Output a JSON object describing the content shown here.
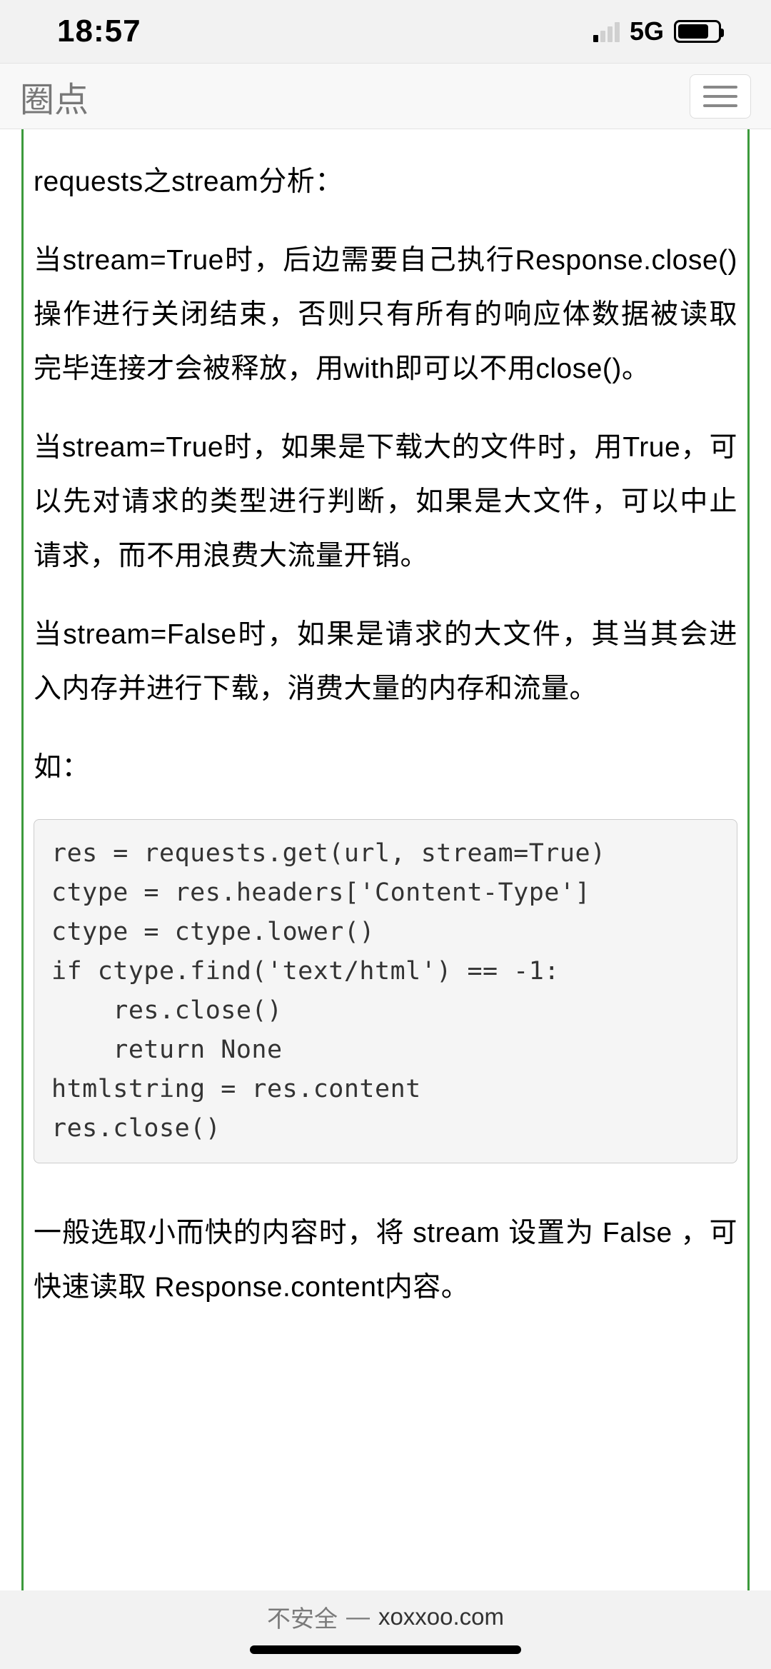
{
  "status": {
    "time": "18:57",
    "network": "5G"
  },
  "nav": {
    "title": "圈点"
  },
  "article": {
    "p1": "requests之stream分析：",
    "p2": "当stream=True时，后边需要自己执行Response.close()操作进行关闭结束，否则只有所有的响应体数据被读取完毕连接才会被释放，用with即可以不用close()。",
    "p3": "当stream=True时，如果是下载大的文件时，用True，可以先对请求的类型进行判断，如果是大文件，可以中止请求，而不用浪费大流量开销。",
    "p4": "当stream=False时，如果是请求的大文件，其当其会进入内存并进行下载，消费大量的内存和流量。",
    "p5": "如：",
    "code": "res = requests.get(url, stream=True)\nctype = res.headers['Content-Type']\nctype = ctype.lower()\nif ctype.find('text/html') == -1:\n    res.close()\n    return None\nhtmlstring = res.content\nres.close()",
    "p6": "一般选取小而快的内容时，将 stream 设置为 False ，可快速读取 Response.content内容。"
  },
  "footer": {
    "insecure": "不安全",
    "sep": "—",
    "domain": "xoxxoo.com"
  }
}
